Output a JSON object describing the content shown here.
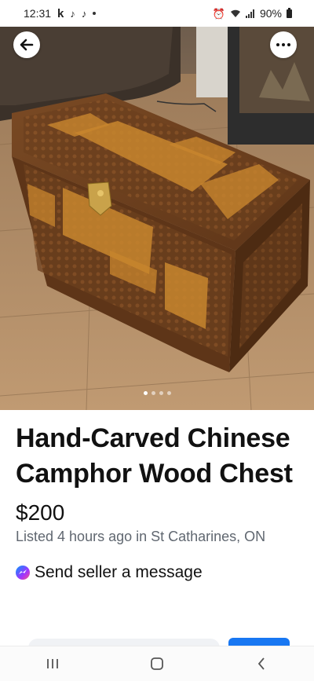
{
  "status_bar": {
    "time": "12:31",
    "notification_icons": [
      "k",
      "tiktok-icon",
      "tiktok-icon"
    ],
    "battery": "90%"
  },
  "listing": {
    "title": "Hand-Carved Chinese Camphor Wood Chest",
    "price": "$200",
    "listed": "Listed 4 hours ago in St Catharines, ON",
    "photo_index": 1,
    "photo_count": 4
  },
  "actions": {
    "send_message_label": "Send seller a message"
  },
  "colors": {
    "accent": "#1877f2",
    "meta_text": "#606770"
  }
}
